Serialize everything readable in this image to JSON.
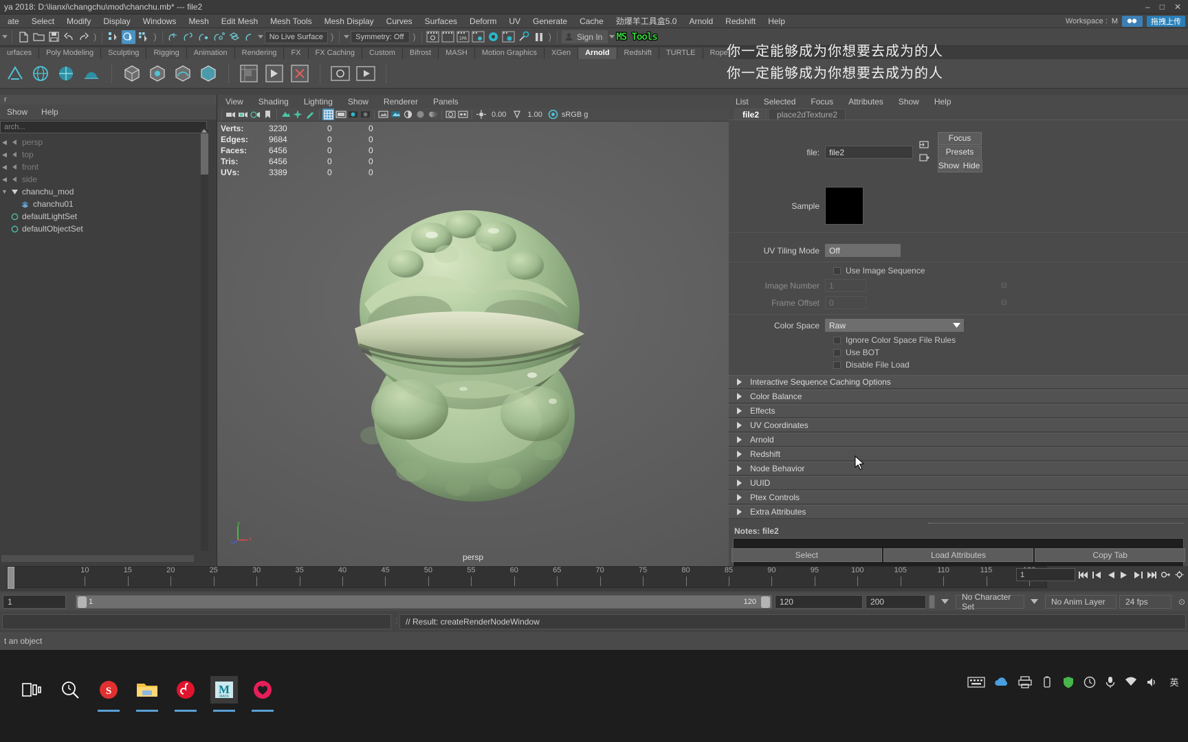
{
  "titlebar": {
    "title": "ya 2018: D:\\lianxi\\changchu\\mod\\chanchu.mb*   ---   file2",
    "minimize": "–",
    "maximize": "□",
    "close": "✕"
  },
  "menubar": {
    "items": [
      "ate",
      "Select",
      "Modify",
      "Display",
      "Windows",
      "Mesh",
      "Edit Mesh",
      "Mesh Tools",
      "Mesh Display",
      "Curves",
      "Surfaces",
      "Deform",
      "UV",
      "Generate",
      "Cache",
      "劲爆羊工具盒5.0",
      "Arnold",
      "Redshift",
      "Help"
    ],
    "workspace_label": "Workspace :",
    "workspace_value": "M",
    "upload_badge": "拖拽上传"
  },
  "statusline": {
    "live_surface": "No Live Surface",
    "symmetry": "Symmetry: Off",
    "signin": "Sign In",
    "mstools": "MS Tools"
  },
  "shelf_tabs": {
    "items": [
      "urfaces",
      "Poly Modeling",
      "Sculpting",
      "Rigging",
      "Animation",
      "Rendering",
      "FX",
      "FX Caching",
      "Custom",
      "Bifrost",
      "MASH",
      "Motion Graphics",
      "XGen",
      "Arnold",
      "Redshift",
      "TURTLE",
      "Rope"
    ],
    "active": "Arnold"
  },
  "outliner": {
    "tab_label": "r",
    "menu": [
      "Show",
      "Help"
    ],
    "search_placeholder": "arch...",
    "items": [
      {
        "label": "persp",
        "dim": true,
        "arrow": "◀",
        "icon": "camera-icon"
      },
      {
        "label": "top",
        "dim": true,
        "arrow": "◀",
        "icon": "camera-icon"
      },
      {
        "label": "front",
        "dim": true,
        "arrow": "◀",
        "icon": "camera-icon"
      },
      {
        "label": "side",
        "dim": true,
        "arrow": "◀",
        "icon": "camera-icon"
      },
      {
        "label": "chanchu_mod",
        "dim": false,
        "arrow": "▼",
        "icon": "group-icon"
      },
      {
        "label": "chanchu01",
        "dim": false,
        "arrow": "",
        "icon": "mesh-icon"
      },
      {
        "label": "defaultLightSet",
        "dim": false,
        "arrow": "",
        "icon": "set-icon"
      },
      {
        "label": "defaultObjectSet",
        "dim": false,
        "arrow": "",
        "icon": "set-icon"
      }
    ]
  },
  "viewport": {
    "menu": [
      "View",
      "Shading",
      "Lighting",
      "Show",
      "Renderer",
      "Panels"
    ],
    "exposure": "0.00",
    "gamma": "1.00",
    "gamma_mode": "sRGB g",
    "label": "persp",
    "hud": {
      "rows": [
        {
          "name": "Verts:",
          "total": "3230",
          "b": "0",
          "c": "0"
        },
        {
          "name": "Edges:",
          "total": "9684",
          "b": "0",
          "c": "0"
        },
        {
          "name": "Faces:",
          "total": "6456",
          "b": "0",
          "c": "0"
        },
        {
          "name": "Tris:",
          "total": "6456",
          "b": "0",
          "c": "0"
        },
        {
          "name": "UVs:",
          "total": "3389",
          "b": "0",
          "c": "0"
        }
      ]
    },
    "axis": {
      "x": "x",
      "y": "y",
      "z": "z"
    }
  },
  "attribute_editor": {
    "menu": [
      "List",
      "Selected",
      "Focus",
      "Attributes",
      "Show",
      "Help"
    ],
    "tabs": [
      {
        "label": "file2",
        "active": true
      },
      {
        "label": "place2dTexture2",
        "active": false
      }
    ],
    "file_label": "file:",
    "file_value": "file2",
    "buttons": {
      "focus": "Focus",
      "presets": "Presets",
      "show": "Show",
      "hide": "Hide"
    },
    "sample_label": "Sample",
    "uv_tiling_label": "UV Tiling Mode",
    "uv_tiling_value": "Off",
    "use_image_sequence": "Use Image Sequence",
    "image_number_label": "Image Number",
    "image_number_value": "1",
    "frame_offset_label": "Frame Offset",
    "frame_offset_value": "0",
    "color_space_label": "Color Space",
    "color_space_value": "Raw",
    "checkboxes": [
      "Ignore Color Space File Rules",
      "Use BOT",
      "Disable File Load"
    ],
    "sections": [
      "Interactive Sequence Caching Options",
      "Color Balance",
      "Effects",
      "UV Coordinates",
      "Arnold",
      "Redshift",
      "Node Behavior",
      "UUID",
      "Ptex Controls",
      "Extra Attributes"
    ],
    "notes_label": "Notes:",
    "notes_value": "file2",
    "footer_buttons": [
      "Select",
      "Load Attributes",
      "Copy Tab"
    ]
  },
  "overlay_text": {
    "line1": "你一定能够成为你想要去成为的人",
    "line2": "你一定能够成为你想要去成为的人"
  },
  "timeline": {
    "ticks": [
      10,
      15,
      20,
      25,
      30,
      35,
      40,
      45,
      50,
      55,
      60,
      65,
      70,
      75,
      80,
      85,
      90,
      95,
      100,
      105,
      110,
      115,
      120
    ],
    "current_frame": "1",
    "current_frame_field": "1"
  },
  "range": {
    "start_field": "1",
    "bar_start": "1",
    "bar_end": "120",
    "anim_end": "120",
    "playback_end": "200",
    "character_set": "No Character Set",
    "anim_layer": "No Anim Layer",
    "fps": "24 fps"
  },
  "command_line": {
    "result": "// Result: createRenderNodeWindow"
  },
  "help_line": {
    "text": "t an object"
  },
  "taskbar": {
    "icons": [
      "task-view-icon",
      "search-icon",
      "sogou-icon",
      "file-explorer-icon",
      "netease-music-icon",
      "maya-icon",
      "heart-app-icon"
    ],
    "tray": [
      "keyboard-icon",
      "onedrive-icon",
      "printer-icon",
      "battery-icon",
      "shield-icon",
      "clock-icon",
      "mic-icon",
      "network-icon",
      "volume-icon",
      "ime-icon"
    ]
  },
  "colors": {
    "accent": "#4b93c4",
    "panel": "#4a4a4a",
    "dark": "#3a3a3a",
    "green_text": "#35d13a"
  }
}
